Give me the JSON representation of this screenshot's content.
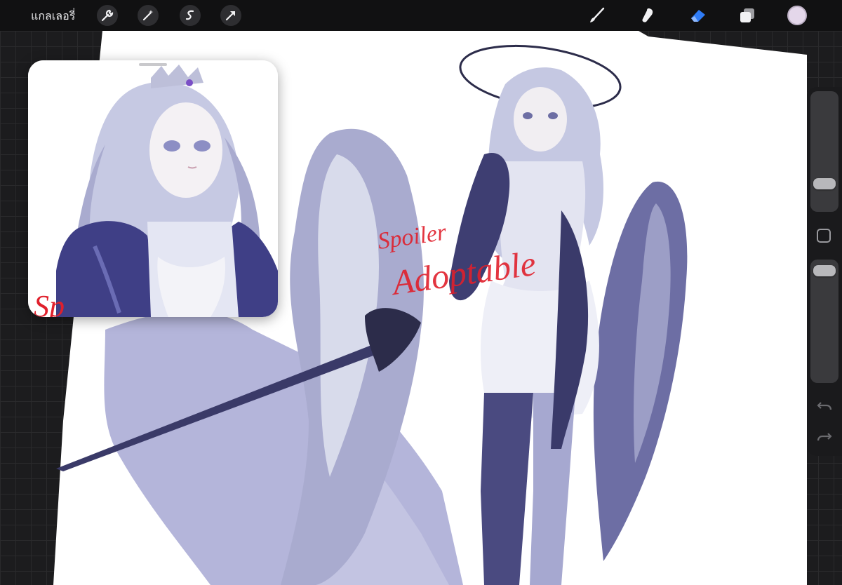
{
  "toolbar": {
    "gallery_label": "แกลเลอรี่",
    "left_tools": [
      "wrench-icon",
      "magic-wand-icon",
      "selection-icon",
      "transform-arrow-icon"
    ],
    "right_tools": [
      "brush-icon",
      "smudge-icon",
      "eraser-icon",
      "layers-icon"
    ],
    "active_tool": "eraser-icon",
    "accent_color": "#2f7cf6",
    "current_color": "#e4d7ea"
  },
  "canvas": {
    "watermark_line1": "Spoiler",
    "watermark_line2": "Adoptable",
    "palette": {
      "hair": "#c7cbe3",
      "shadow": "#a6a8d0",
      "dark": "#4a4a80",
      "wing": "#9ea0c8",
      "skin": "#f1eef2"
    }
  },
  "reference_window": {
    "watermark_partial": "Sp"
  },
  "sidebar": {
    "brush_size_level": 0.78,
    "opacity_level": 0.08
  }
}
